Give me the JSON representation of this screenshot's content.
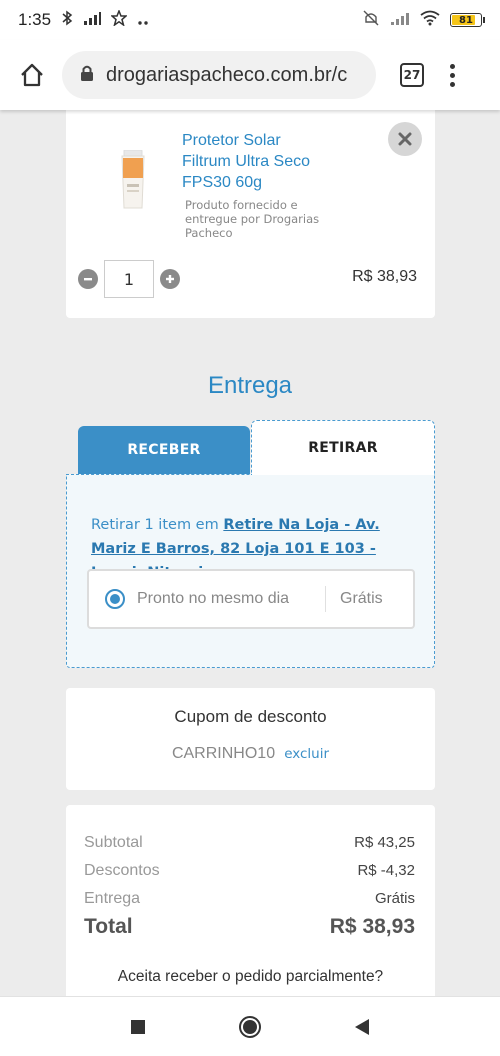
{
  "status_bar": {
    "time": "1:35",
    "battery": "81",
    "battery_level": 0.81,
    "icons": [
      "bluetooth-icon",
      "data-icon",
      "star-icon",
      "more-dots-icon",
      "mute-icon",
      "signal-icon",
      "wifi-icon",
      "battery-icon"
    ]
  },
  "browser": {
    "url": "drogariaspacheco.com.br/c",
    "tab_count": "27"
  },
  "product": {
    "name": "Protetor Solar Filtrum Ultra Seco FPS30 60g",
    "seller": "Produto fornecido e entregue por Drogarias Pacheco",
    "quantity": "1",
    "price": "R$ 38,93"
  },
  "delivery": {
    "title": "Entrega",
    "tabs": [
      {
        "label": "RECEBER",
        "active": false
      },
      {
        "label": "RETIRAR",
        "active": true
      }
    ],
    "pickup_prefix": "Retirar 1 item em ",
    "pickup_store": "Retire Na Loja - Av. Mariz E Barros, 82 Loja 101 E 103 - Icarai, Niteroi",
    "option_label": "Pronto no mesmo dia",
    "option_price": "Grátis"
  },
  "coupon": {
    "title": "Cupom de desconto",
    "code": "CARRINHO10",
    "remove_label": "excluir"
  },
  "summary": {
    "rows": [
      {
        "label": "Subtotal",
        "value": "R$ 43,25"
      },
      {
        "label": "Descontos",
        "value": "R$ -4,32"
      },
      {
        "label": "Entrega",
        "value": "Grátis"
      }
    ],
    "total_label": "Total",
    "total_value": "R$ 38,93",
    "partial_question": "Aceita receber o pedido parcialmente?"
  },
  "colors": {
    "accent": "#3b8fc7",
    "link": "#2b88c4",
    "background": "#ececec"
  }
}
